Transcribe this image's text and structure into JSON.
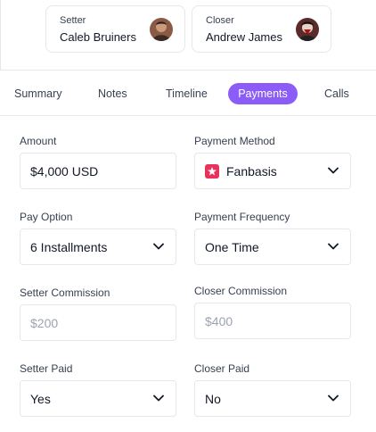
{
  "people": {
    "setter": {
      "role": "Setter",
      "name": "Caleb Bruiners"
    },
    "closer": {
      "role": "Closer",
      "name": "Andrew James"
    }
  },
  "tabs": [
    {
      "label": "Summary",
      "active": false
    },
    {
      "label": "Notes",
      "active": false
    },
    {
      "label": "Timeline",
      "active": false
    },
    {
      "label": "Payments",
      "active": true
    },
    {
      "label": "Calls",
      "active": false
    }
  ],
  "form": {
    "amount": {
      "label": "Amount",
      "value": "$4,000 USD"
    },
    "payment_method": {
      "label": "Payment Method",
      "value": "Fanbasis",
      "icon": "fanbasis-logo-icon"
    },
    "pay_option": {
      "label": "Pay Option",
      "value": "6 Installments"
    },
    "payment_frequency": {
      "label": "Payment Frequency",
      "value": "One Time"
    },
    "setter_commission": {
      "label": "Setter Commission",
      "value": "$200"
    },
    "closer_commission": {
      "label": "Closer Commission",
      "value": "$400"
    },
    "setter_paid": {
      "label": "Setter Paid",
      "value": "Yes"
    },
    "closer_paid": {
      "label": "Closer Paid",
      "value": "No"
    }
  },
  "colors": {
    "accent": "#8b5cf6",
    "fanbasis": "#e8315b",
    "border": "#e5e7eb",
    "muted_text": "#9ca3af"
  }
}
